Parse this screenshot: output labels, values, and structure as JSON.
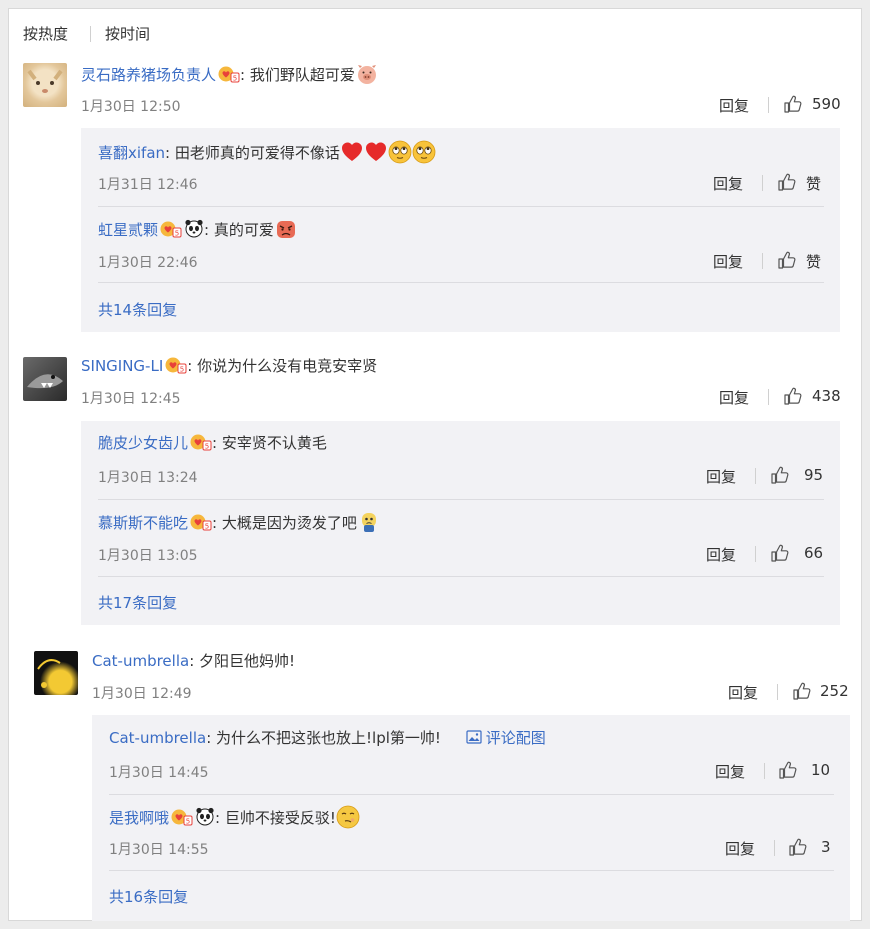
{
  "sort_tabs": {
    "hot": "按热度",
    "time": "按时间"
  },
  "comments": [
    {
      "user": "灵石路养猪场负责人",
      "text": "我们野队超可爱",
      "time": "1月30日 12:50",
      "reply_label": "回复",
      "likes": "590",
      "replies": [
        {
          "user": "喜翻xifan",
          "text": "田老师真的可爱得不像话",
          "time": "1月31日 12:46",
          "reply_label": "回复",
          "likes": "赞"
        },
        {
          "user": "虹星贰颗",
          "text": "真的可爱",
          "time": "1月30日 22:46",
          "reply_label": "回复",
          "likes": "赞"
        }
      ],
      "more": "共14条回复"
    },
    {
      "user": "SINGING-LI",
      "text": "你说为什么没有电竞安宰贤",
      "time": "1月30日 12:45",
      "reply_label": "回复",
      "likes": "438",
      "replies": [
        {
          "user": "脆皮少女齿儿",
          "text": "安宰贤不认黄毛",
          "time": "1月30日 13:24",
          "reply_label": "回复",
          "likes": "95"
        },
        {
          "user": "慕斯斯不能吃",
          "text": "大概是因为烫发了吧",
          "time": "1月30日 13:05",
          "reply_label": "回复",
          "likes": "66"
        }
      ],
      "more": "共17条回复"
    },
    {
      "user": "Cat-umbrella",
      "text": "夕阳巨他妈帅!",
      "time": "1月30日 12:49",
      "reply_label": "回复",
      "likes": "252",
      "replies": [
        {
          "user": "Cat-umbrella",
          "text": "为什么不把这张也放上!lpl第一帅!",
          "pic_label": "评论配图",
          "time": "1月30日 14:45",
          "reply_label": "回复",
          "likes": "10"
        },
        {
          "user": "是我啊哦",
          "text": "巨帅不接受反驳!",
          "time": "1月30日 14:55",
          "reply_label": "回复",
          "likes": "3"
        }
      ],
      "more": "共16条回复"
    }
  ],
  "colors": {
    "link": "#3a6cc4",
    "text": "#333333",
    "meta": "#808080",
    "subbg": "#f2f2f5"
  }
}
